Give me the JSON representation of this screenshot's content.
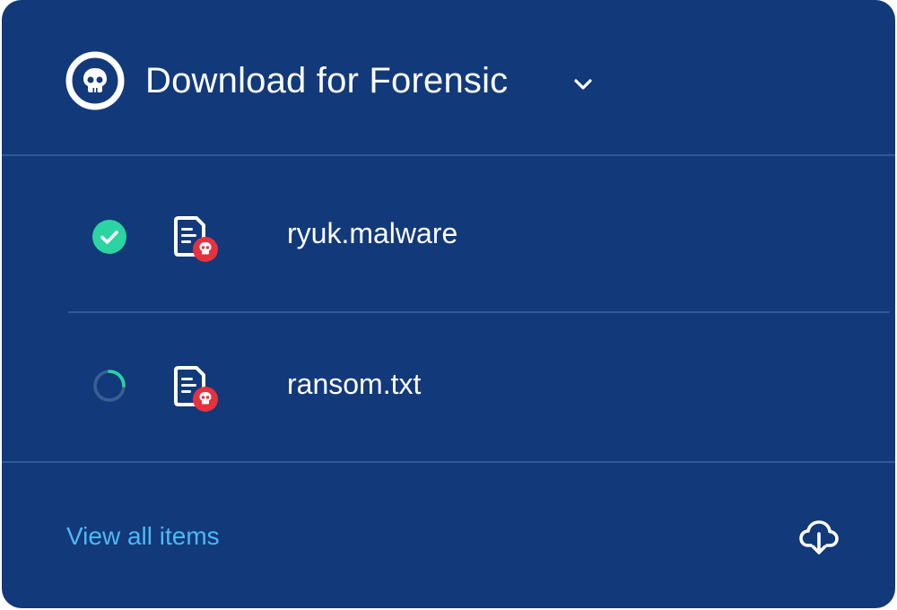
{
  "header": {
    "title": "Download for Forensic",
    "badge_icon": "skull-icon",
    "toggle_icon": "chevron-down-icon"
  },
  "items": [
    {
      "name": "ryuk.malware",
      "status": "complete",
      "status_icon": "check-circle-icon",
      "file_icon": "malware-file-icon"
    },
    {
      "name": "ransom.txt",
      "status": "in-progress",
      "status_icon": "spinner-icon",
      "file_icon": "malware-file-icon"
    }
  ],
  "footer": {
    "link_label": "View all items",
    "download_icon": "cloud-download-icon"
  },
  "colors": {
    "background": "#12397A",
    "divider": "#2F5A99",
    "success": "#2BD4A0",
    "danger": "#E5323E",
    "link": "#4FB8F4",
    "spinner_track": "#3A5F95"
  }
}
